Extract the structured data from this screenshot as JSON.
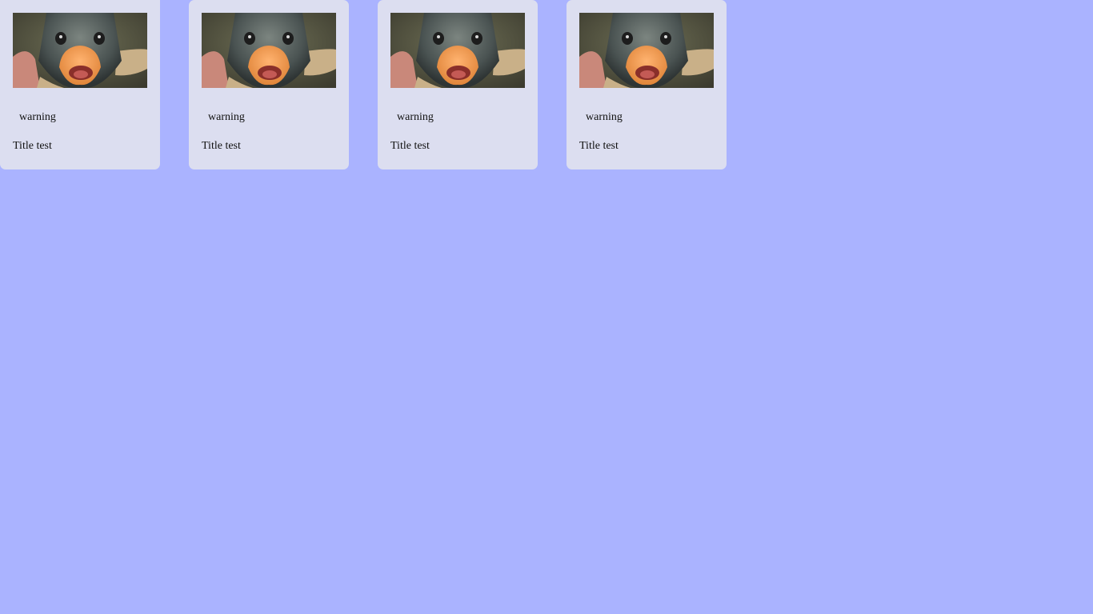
{
  "cards": [
    {
      "badge": "warning",
      "title": "Title test",
      "image": "fish-photo"
    },
    {
      "badge": "warning",
      "title": "Title test",
      "image": "fish-photo"
    },
    {
      "badge": "warning",
      "title": "Title test",
      "image": "fish-photo"
    },
    {
      "badge": "warning",
      "title": "Title test",
      "image": "fish-photo"
    }
  ],
  "colors": {
    "background": "#aab3ff",
    "card": "#dcdef0",
    "text": "#111111"
  }
}
